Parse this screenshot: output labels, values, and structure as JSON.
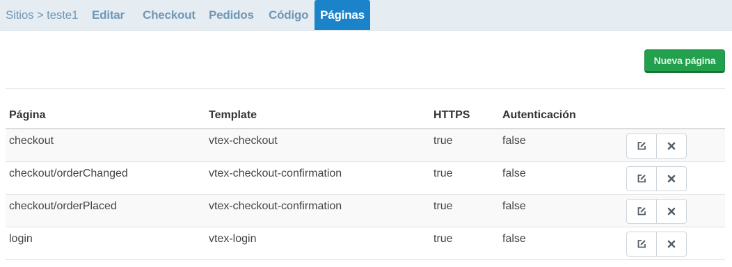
{
  "nav": {
    "breadcrumb": "Sitios > teste1",
    "tabs": [
      {
        "label": "Editar",
        "active": false
      },
      {
        "label": "Checkout",
        "active": false
      },
      {
        "label": "Pedidos",
        "active": false
      },
      {
        "label": "Código",
        "active": false
      },
      {
        "label": "Páginas",
        "active": true
      }
    ]
  },
  "actions": {
    "new_page_label": "Nueva página"
  },
  "table": {
    "headers": [
      "Página",
      "Template",
      "HTTPS",
      "Autenticación"
    ],
    "rows": [
      {
        "page": "checkout",
        "template": "vtex-checkout",
        "https": "true",
        "auth": "false"
      },
      {
        "page": "checkout/orderChanged",
        "template": "vtex-checkout-confirmation",
        "https": "true",
        "auth": "false"
      },
      {
        "page": "checkout/orderPlaced",
        "template": "vtex-checkout-confirmation",
        "https": "true",
        "auth": "false"
      },
      {
        "page": "login",
        "template": "vtex-login",
        "https": "true",
        "auth": "false"
      }
    ],
    "row_actions": [
      "edit-icon",
      "delete-icon"
    ]
  },
  "colors": {
    "nav_bg": "#e6edf2",
    "nav_text": "#6f97b6",
    "active_tab": "#1b83c9",
    "primary_green": "#23a04d",
    "icon": "#55606a"
  }
}
